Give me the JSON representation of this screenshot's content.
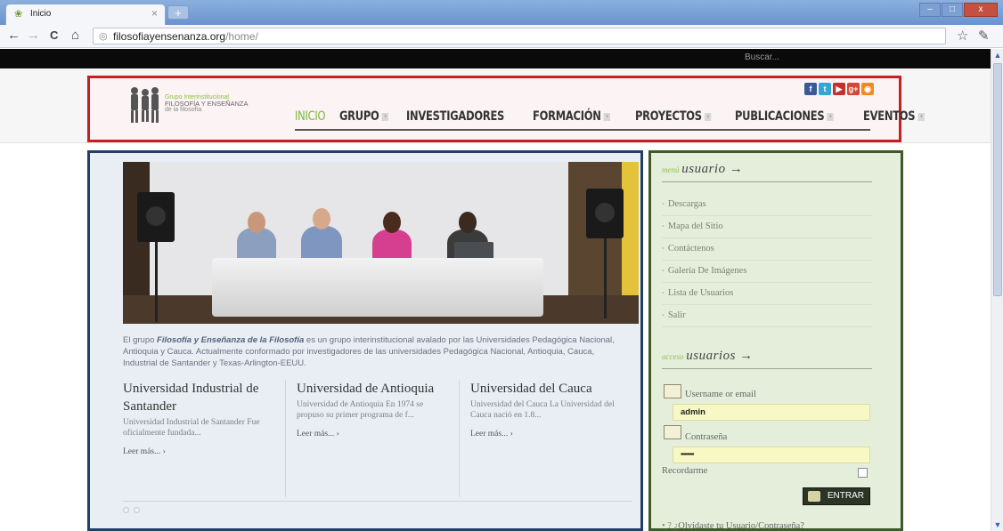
{
  "browser": {
    "tab_title": "Inicio",
    "tab_close": "×",
    "new_tab": "+",
    "url_host": "filosofiayensenanza.org",
    "url_path": "/home/",
    "back": "←",
    "forward": "→",
    "reload": "C",
    "home": "⌂",
    "star": "☆",
    "wrench": "🔧",
    "win_min": "–",
    "win_max": "□",
    "win_close": "x"
  },
  "topbar": {
    "search_label": "Buscar..."
  },
  "logo": {
    "line1": "Grupo Interinstitucional",
    "line2": "FILOSOFÍA Y ENSEÑANZA",
    "line3": "de la filosofía"
  },
  "social": {
    "facebook": "f",
    "twitter": "t",
    "youtube": "▶",
    "googleplus": "g+",
    "rss": "◉",
    "colors": {
      "facebook": "#3b5998",
      "twitter": "#33a6d8",
      "youtube": "#c4302b",
      "googleplus": "#d34836",
      "rss": "#f08a24"
    }
  },
  "nav": {
    "items": [
      {
        "label": "INICIO"
      },
      {
        "label": "GRUPO"
      },
      {
        "label": "INVESTIGADORES"
      },
      {
        "label": "FORMACIÓN"
      },
      {
        "label": "PROYECTOS"
      },
      {
        "label": "PUBLICACIONES"
      },
      {
        "label": "EVENTOS"
      }
    ]
  },
  "intro": {
    "pre": "El grupo ",
    "em": "Filosofía y Enseñanza de la Filosofía",
    "post": " es un grupo interinstitucional avalado por las Universidades Pedagógica Nacional, Antioquia y Cauca. Actualmente conformado por investigadores de las universidades Pedagógica Nacional, Antioquia, Cauca, Industrial de Santander y Texas-Arlington-EEUU."
  },
  "columns": [
    {
      "title": "Universidad Industrial de Santander",
      "text": "Universidad Industrial de Santander  Fue oficialmente fundada...",
      "more": "Leer más... ›"
    },
    {
      "title": "Universidad de Antioquia",
      "text": "Universidad de Antioquia En 1974 se propuso su primer programa de f...",
      "more": "Leer más... ›"
    },
    {
      "title": "Universidad del Cauca",
      "text": "Universidad del Cauca  La Universidad del Cauca nació en 1.8...",
      "more": "Leer más... ›"
    }
  ],
  "sidebar": {
    "menu_small": "menú",
    "menu_big": "usuario →",
    "menu_items": [
      {
        "label": "Descargas"
      },
      {
        "label": "Mapa del Sitio"
      },
      {
        "label": "Contáctenos"
      },
      {
        "label": "Galería De Imágenes"
      },
      {
        "label": "Lista de Usuarios"
      },
      {
        "label": "Salir"
      }
    ],
    "access_small": "acceso",
    "access_big": "usuarios →",
    "username_label": "Username or email",
    "username_value": "admin",
    "password_label": "Contraseña",
    "password_value": "••••••••••",
    "remember_label": "Recordarme",
    "login_button": "ENTRAR",
    "forgot": "¿Olvidaste tu Usuario/Contraseña?"
  },
  "scrollbar": {
    "up": "▲",
    "down": "▼"
  }
}
